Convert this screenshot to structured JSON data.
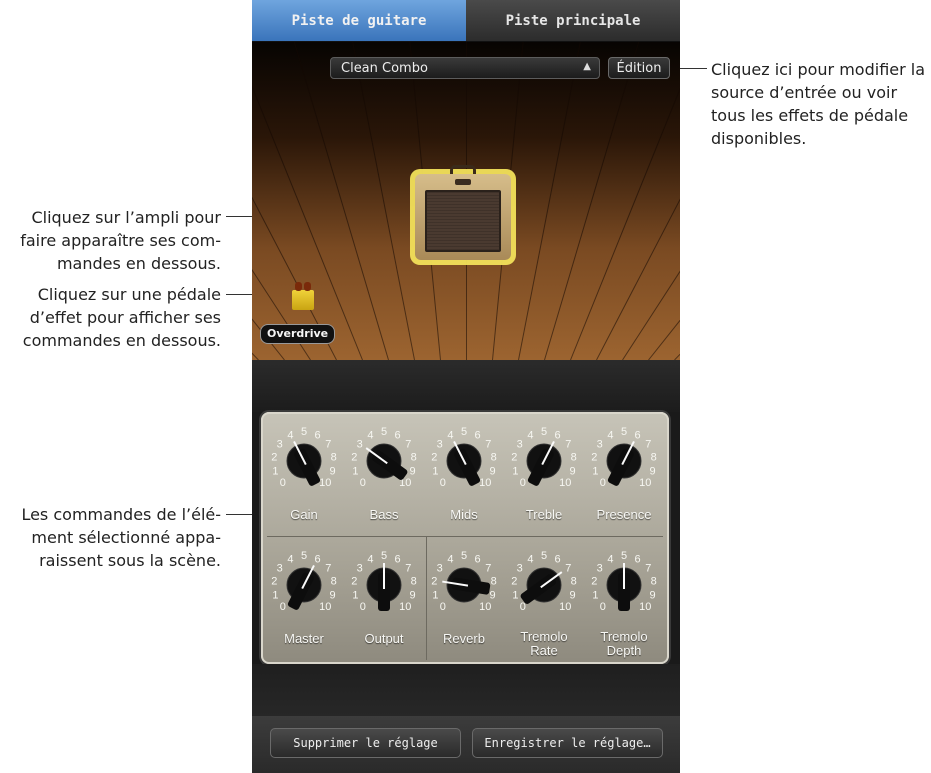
{
  "tabs": [
    {
      "label": "Piste de guitare",
      "active": true
    },
    {
      "label": "Piste principale",
      "active": false
    }
  ],
  "preset": {
    "value": "Clean Combo",
    "edit_label": "Édition"
  },
  "stage": {
    "pedal_label": "Overdrive"
  },
  "knobs": [
    {
      "label": "Gain",
      "scale": [
        "0",
        "1",
        "2",
        "3",
        "4",
        "5",
        "6",
        "7",
        "8",
        "9",
        "10"
      ],
      "value": 4
    },
    {
      "label": "Bass",
      "scale": [
        "0",
        "1",
        "2",
        "3",
        "4",
        "5",
        "6",
        "7",
        "8",
        "9",
        "10"
      ],
      "value": 3
    },
    {
      "label": "Mids",
      "scale": [
        "0",
        "1",
        "2",
        "3",
        "4",
        "5",
        "6",
        "7",
        "8",
        "9",
        "10"
      ],
      "value": 4
    },
    {
      "label": "Treble",
      "scale": [
        "0",
        "1",
        "2",
        "3",
        "4",
        "5",
        "6",
        "7",
        "8",
        "9",
        "10"
      ],
      "value": 6
    },
    {
      "label": "Presence",
      "scale": [
        "0",
        "1",
        "2",
        "3",
        "4",
        "5",
        "6",
        "7",
        "8",
        "9",
        "10"
      ],
      "value": 6
    },
    {
      "label": "Master",
      "scale": [
        "0",
        "1",
        "2",
        "3",
        "4",
        "5",
        "6",
        "7",
        "8",
        "9",
        "10"
      ],
      "value": 6
    },
    {
      "label": "Output",
      "scale": [
        "0",
        "1",
        "2",
        "3",
        "4",
        "5",
        "6",
        "7",
        "8",
        "9",
        "10"
      ],
      "value": 5
    },
    {
      "label": "Reverb",
      "scale": [
        "0",
        "1",
        "2",
        "3",
        "4",
        "5",
        "6",
        "7",
        "8",
        "9",
        "10"
      ],
      "value": 2
    },
    {
      "label": "Tremolo Rate",
      "scale": [
        "0",
        "1",
        "2",
        "3",
        "4",
        "5",
        "6",
        "7",
        "8",
        "9",
        "10"
      ],
      "value": 7
    },
    {
      "label": "Tremolo Depth",
      "scale": [
        "0",
        "1",
        "2",
        "3",
        "4",
        "5",
        "6",
        "7",
        "8",
        "9",
        "10"
      ],
      "value": 5
    }
  ],
  "footer": {
    "delete_label": "Supprimer le réglage",
    "save_label": "Enregistrer le réglage…"
  },
  "callouts": {
    "edit": "Cliquez ici pour modifier la source d’entrée ou voir tous les effets de pédale disponibles.",
    "amp": "Cliquez sur l’ampli pour faire apparaître ses com-mandes en dessous.",
    "pedal": "Cliquez sur une pédale d’effet pour afficher ses commandes en dessous.",
    "controls": "Les commandes de l’élé-ment sélectionné appa-raissent sous la scène."
  },
  "colors": {
    "tab_active": "#4a86cc",
    "amp_highlight": "#f2e05b",
    "panel": "#b7b4a8"
  }
}
